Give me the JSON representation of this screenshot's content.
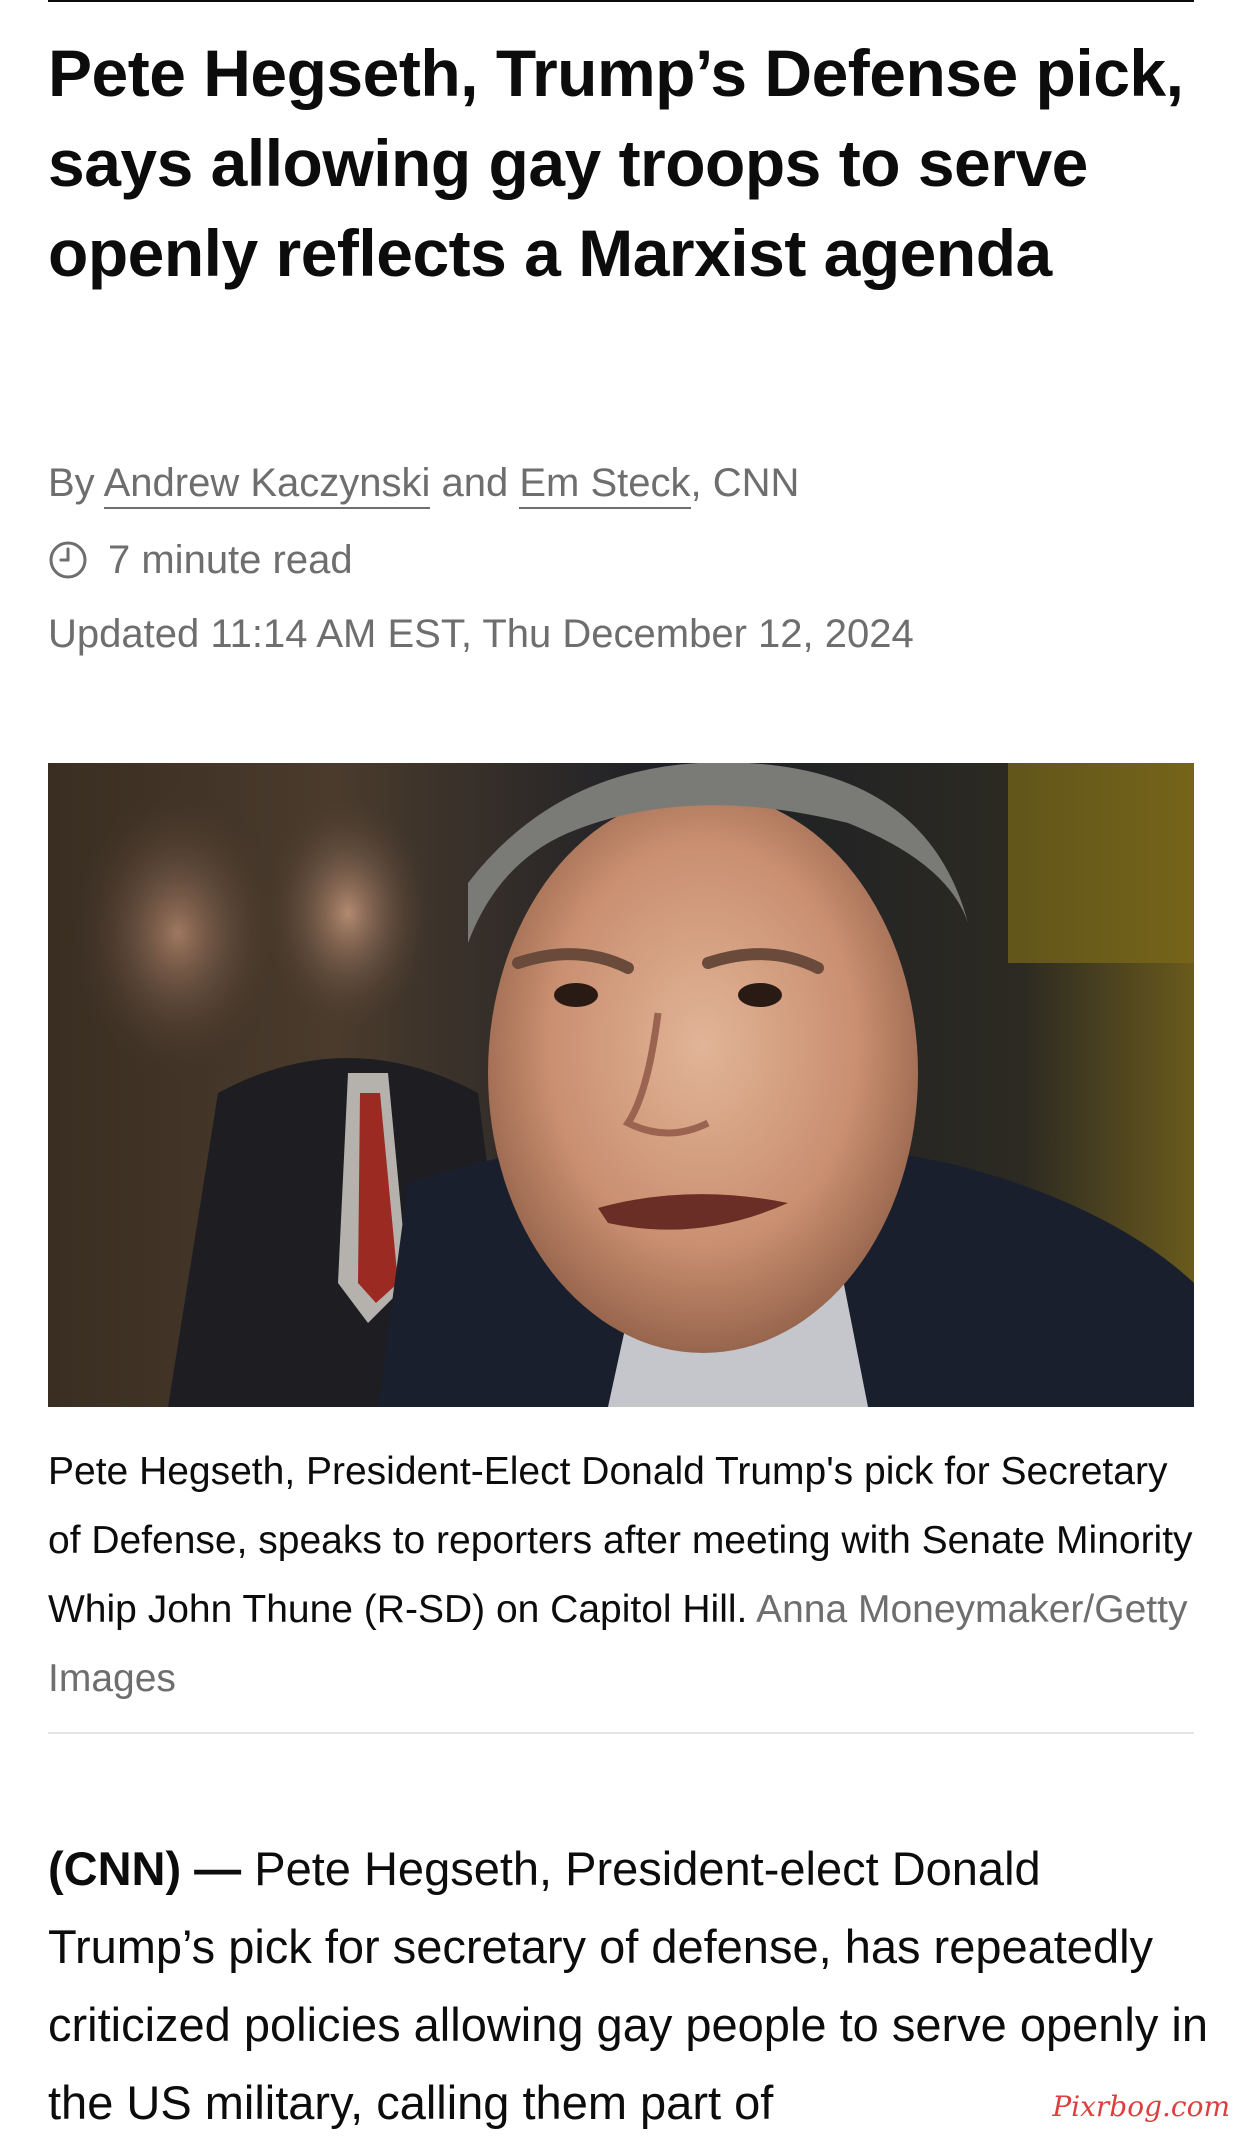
{
  "article": {
    "headline": "Pete Hegseth, Trump’s Defense pick, says allowing gay troops to serve openly reflects a Marxist agenda",
    "byline": {
      "prefix": "By ",
      "author1": "Andrew Kaczynski",
      "joiner": " and ",
      "author2": "Em Steck",
      "outlet": ", CNN"
    },
    "read_time": "7 minute read",
    "updated": "Updated 11:14 AM EST, Thu December 12, 2024",
    "image": {
      "caption": "Pete Hegseth, President-Elect Donald Trump's pick for Secretary of Defense, speaks to reporters after meeting with Senate Minority Whip John Thune (R-SD) on Capitol Hill. ",
      "credit": "Anna Moneymaker/Getty Images"
    },
    "body": {
      "dateline": "(CNN) —",
      "text": " Pete Hegseth, President-elect Donald Trump’s pick for secretary of defense, has repeatedly criticized policies allowing gay people to serve openly in the US military, calling them part of"
    }
  },
  "watermark": "Pixrbog.com",
  "icons": {
    "clock": "clock-icon"
  },
  "colors": {
    "text": "#0c0c0c",
    "muted": "#6e6e6e",
    "divider": "#e4e4e4",
    "watermark": "#d81e1e"
  }
}
